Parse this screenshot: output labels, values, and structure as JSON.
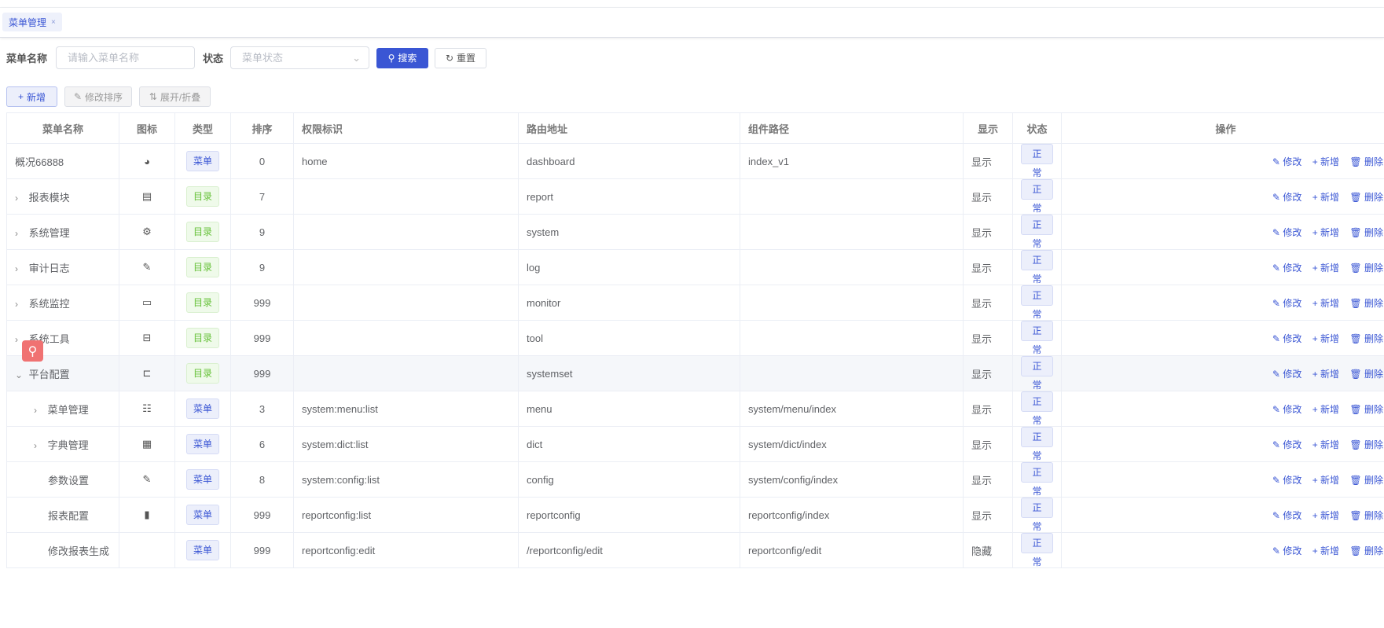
{
  "tabs": [
    {
      "label": "菜单管理",
      "close": "×"
    }
  ],
  "search": {
    "name_label": "菜单名称",
    "name_placeholder": "请输入菜单名称",
    "status_label": "状态",
    "status_placeholder": "菜单状态",
    "search_btn": "搜索",
    "reset_btn": "重置"
  },
  "toolbar": {
    "add": "新增",
    "sort": "修改排序",
    "expand": "展开/折叠"
  },
  "columns": [
    "菜单名称",
    "图标",
    "类型",
    "排序",
    "权限标识",
    "路由地址",
    "组件路径",
    "显示",
    "状态",
    "操作"
  ],
  "rows": [
    {
      "name": "概况66888",
      "level": 0,
      "caret": "",
      "icon": "dashboard-icon",
      "glyph": "◕",
      "type": "菜单",
      "order": "0",
      "perm": "home",
      "route": "dashboard",
      "component": "index_v1",
      "visible": "显示",
      "status": "正常"
    },
    {
      "name": "报表模块",
      "level": 0,
      "caret": "›",
      "icon": "report-icon",
      "glyph": "▤",
      "type": "目录",
      "order": "7",
      "perm": "",
      "route": "report",
      "component": "",
      "visible": "显示",
      "status": "正常"
    },
    {
      "name": "系统管理",
      "level": 0,
      "caret": "›",
      "icon": "gear-icon",
      "glyph": "⚙",
      "type": "目录",
      "order": "9",
      "perm": "",
      "route": "system",
      "component": "",
      "visible": "显示",
      "status": "正常"
    },
    {
      "name": "审计日志",
      "level": 0,
      "caret": "›",
      "icon": "edit-log-icon",
      "glyph": "✎",
      "type": "目录",
      "order": "9",
      "perm": "",
      "route": "log",
      "component": "",
      "visible": "显示",
      "status": "正常"
    },
    {
      "name": "系统监控",
      "level": 0,
      "caret": "›",
      "icon": "monitor-icon",
      "glyph": "▭",
      "type": "目录",
      "order": "999",
      "perm": "",
      "route": "monitor",
      "component": "",
      "visible": "显示",
      "status": "正常"
    },
    {
      "name": "系统工具",
      "level": 0,
      "caret": "›",
      "icon": "toolbox-icon",
      "glyph": "⊟",
      "type": "目录",
      "order": "999",
      "perm": "",
      "route": "tool",
      "component": "",
      "visible": "显示",
      "status": "正常"
    },
    {
      "name": "平台配置",
      "level": 0,
      "caret": "⌄",
      "icon": "tree-icon",
      "glyph": "⊏",
      "type": "目录",
      "order": "999",
      "perm": "",
      "route": "systemset",
      "component": "",
      "visible": "显示",
      "status": "正常"
    },
    {
      "name": "菜单管理",
      "level": 1,
      "caret": "›",
      "icon": "tree-table-icon",
      "glyph": "☷",
      "type": "菜单",
      "order": "3",
      "perm": "system:menu:list",
      "route": "menu",
      "component": "system/menu/index",
      "visible": "显示",
      "status": "正常"
    },
    {
      "name": "字典管理",
      "level": 1,
      "caret": "›",
      "icon": "dict-icon",
      "glyph": "▦",
      "type": "菜单",
      "order": "6",
      "perm": "system:dict:list",
      "route": "dict",
      "component": "system/dict/index",
      "visible": "显示",
      "status": "正常"
    },
    {
      "name": "参数设置",
      "level": 1,
      "caret": "",
      "icon": "edit-icon",
      "glyph": "✎",
      "type": "菜单",
      "order": "8",
      "perm": "system:config:list",
      "route": "config",
      "component": "system/config/index",
      "visible": "显示",
      "status": "正常"
    },
    {
      "name": "报表配置",
      "level": 1,
      "caret": "",
      "icon": "chart-icon",
      "glyph": "▮",
      "type": "菜单",
      "order": "999",
      "perm": "reportconfig:list",
      "route": "reportconfig",
      "component": "reportconfig/index",
      "visible": "显示",
      "status": "正常"
    },
    {
      "name": "修改报表生成",
      "level": 1,
      "caret": "",
      "icon": "",
      "glyph": "",
      "type": "菜单",
      "order": "999",
      "perm": "reportconfig:edit",
      "route": "/reportconfig/edit",
      "component": "reportconfig/edit",
      "visible": "隐藏",
      "status": "正常"
    }
  ],
  "ops": {
    "edit": "修改",
    "add": "新增",
    "delete": "删除"
  }
}
